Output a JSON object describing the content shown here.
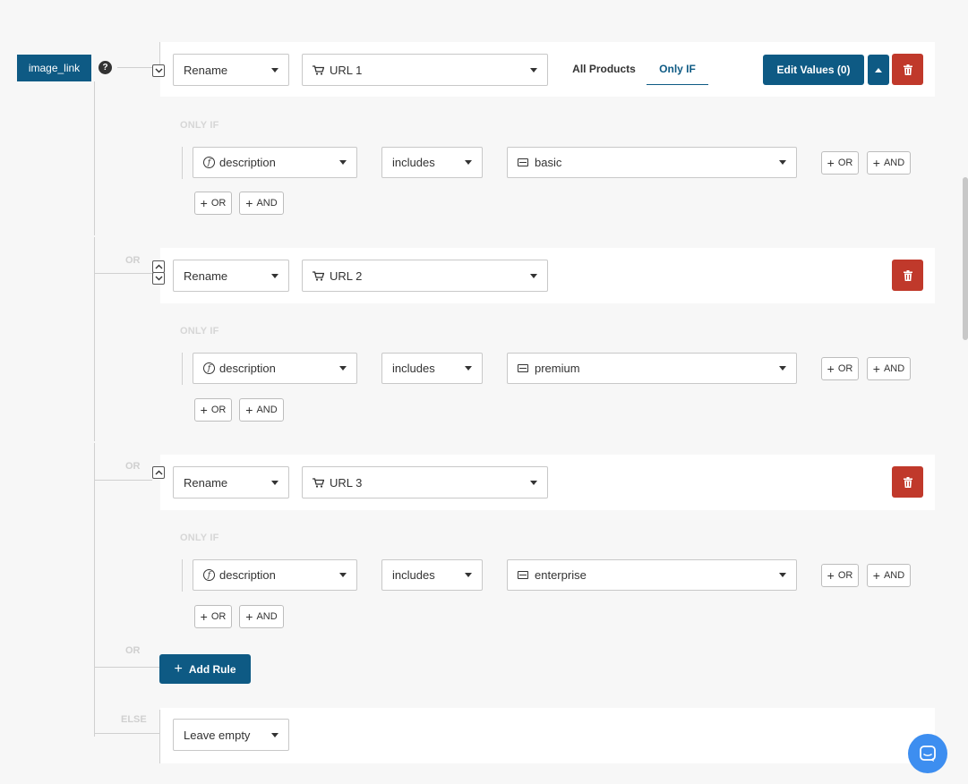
{
  "field": {
    "name": "image_link",
    "help": "?"
  },
  "tabs": {
    "all_products": "All Products",
    "only_if": "Only IF"
  },
  "edit_values_label": "Edit Values (0)",
  "rules": [
    {
      "action": "Rename",
      "value": "URL 1",
      "only_if_label": "ONLY IF",
      "condition": {
        "attribute": "description",
        "operator": "includes",
        "value": "basic"
      }
    },
    {
      "or_label": "OR",
      "action": "Rename",
      "value": "URL 2",
      "only_if_label": "ONLY IF",
      "condition": {
        "attribute": "description",
        "operator": "includes",
        "value": "premium"
      }
    },
    {
      "or_label": "OR",
      "action": "Rename",
      "value": "URL 3",
      "only_if_label": "ONLY IF",
      "condition": {
        "attribute": "description",
        "operator": "includes",
        "value": "enterprise"
      }
    }
  ],
  "buttons": {
    "or": "OR",
    "and": "AND",
    "plus": "+"
  },
  "add_rule": {
    "or_label": "OR",
    "label": "Add Rule"
  },
  "else": {
    "label": "ELSE",
    "action": "Leave empty"
  },
  "colors": {
    "primary": "#0e5a84",
    "danger": "#c0392b",
    "chat": "#3d8ef0"
  },
  "icons": [
    "help-icon",
    "cart-icon",
    "function-icon",
    "text-field-icon",
    "trash-icon",
    "chevron-up-icon",
    "chevron-down-icon",
    "caret-up-icon",
    "plus-icon",
    "chat-icon"
  ]
}
